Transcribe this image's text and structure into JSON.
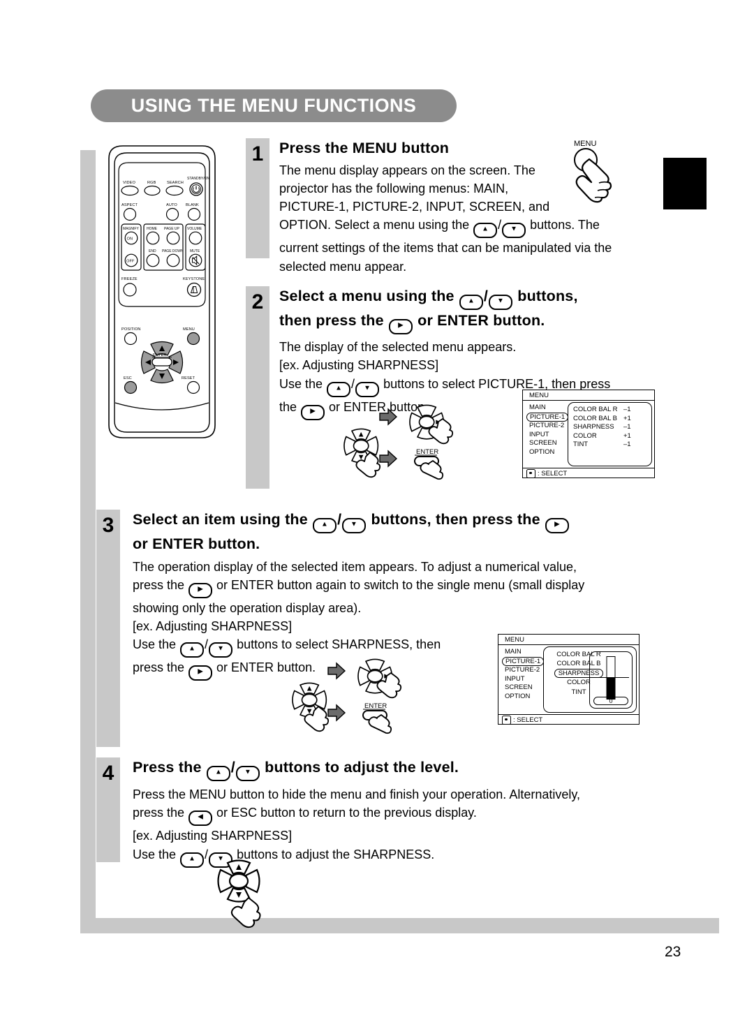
{
  "page": {
    "title": "USING THE MENU FUNCTIONS",
    "number": "23"
  },
  "remote": {
    "name": "projector-remote-control",
    "buttons": [
      "VIDEO",
      "RGB",
      "SEARCH",
      "STANDBY/ON",
      "ASPECT",
      "AUTO",
      "BLANK",
      "MAGNIFY",
      "ON",
      "OFF",
      "HOME",
      "PAGE UP",
      "END",
      "PAGE DOWN",
      "VOLUME",
      "MUTE",
      "FREEZE",
      "KEYSTONE",
      "POSITION",
      "MENU",
      "ESC",
      "RESET",
      "ENTER"
    ]
  },
  "steps": [
    {
      "number": "1",
      "heading": "Press the MENU button",
      "lines": [
        "The menu display appears on the screen. The",
        "projector has the following menus: MAIN,",
        "PICTURE-1, PICTURE-2, INPUT, SCREEN, and",
        "OPTION. Select a menu using the ▲/▼ buttons. The",
        "current settings of the items that can be manipulated via the",
        "selected menu appear."
      ],
      "figure_label": "MENU"
    },
    {
      "number": "2",
      "heading_line1": "Select a menu using the ▲/▼ buttons,",
      "heading_line2": "then press the ▶ or ENTER button.",
      "lines": [
        "The display of the selected menu appears.",
        "[ex. Adjusting SHARPNESS]",
        "Use the ▲/▼ buttons to select PICTURE-1, then press",
        "the ▶ or ENTER button."
      ],
      "figure_label": "ENTER"
    },
    {
      "number": "3",
      "heading_line1": "Select an item using the ▲/▼ buttons, then press the ▶",
      "heading_line2": "or ENTER button.",
      "lines": [
        "The operation display of the selected item appears. To adjust a numerical value,",
        "press the ▶ or ENTER button again to switch to the single menu (small display",
        "showing only the operation display area).",
        "[ex. Adjusting SHARPNESS]",
        "Use the ▲/▼ buttons to select SHARPNESS, then",
        "press the ▶ or ENTER button."
      ],
      "figure_label": "ENTER"
    },
    {
      "number": "4",
      "heading": "Press the ▲/▼ buttons to adjust the level.",
      "lines": [
        "Press the MENU button to hide the menu and finish your operation. Alternatively,",
        "press the ◀ or ESC button to return to the previous display.",
        "[ex. Adjusting SHARPNESS]",
        "Use the ▲/▼ buttons to adjust the SHARPNESS."
      ]
    }
  ],
  "osd_menu_1": {
    "title": "MENU",
    "footer": ": SELECT",
    "menu_items": [
      "MAIN",
      "PICTURE-1",
      "PICTURE-2",
      "INPUT",
      "SCREEN",
      "OPTION"
    ],
    "selected_menu": "PICTURE-1",
    "rows": [
      {
        "name": "COLOR BAL R",
        "value": "–1"
      },
      {
        "name": "COLOR BAL B",
        "value": "+1"
      },
      {
        "name": "SHARPNESS",
        "value": "–1"
      },
      {
        "name": "COLOR",
        "value": "+1"
      },
      {
        "name": "TINT",
        "value": "–1"
      }
    ]
  },
  "osd_menu_2": {
    "title": "MENU",
    "footer": ": SELECT",
    "menu_items": [
      "MAIN",
      "PICTURE-1",
      "PICTURE-2",
      "INPUT",
      "SCREEN",
      "OPTION"
    ],
    "selected_menu": "PICTURE-1",
    "rows": [
      "COLOR BAL R",
      "COLOR BAL B",
      "SHARPNESS",
      "COLOR",
      "TINT"
    ],
    "selected_item": "SHARPNESS",
    "slider_value": "0"
  }
}
